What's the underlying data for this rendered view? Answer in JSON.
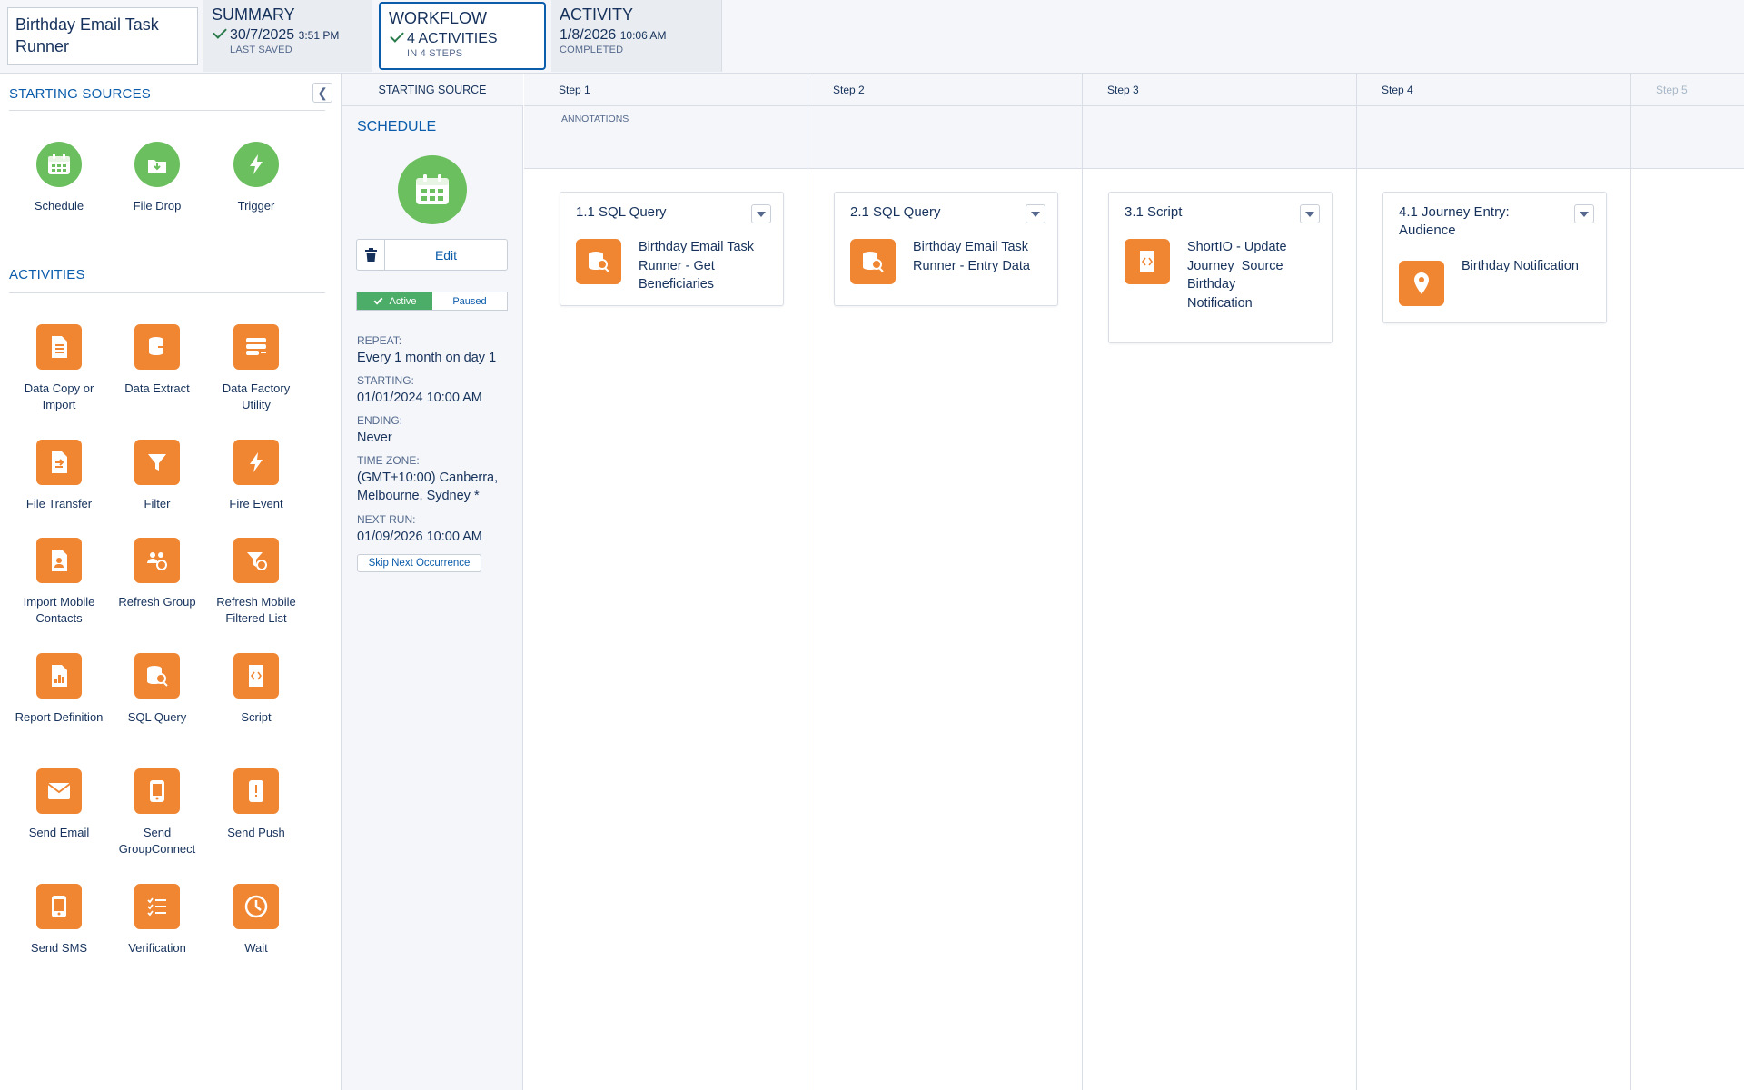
{
  "automation": {
    "name": "Birthday Email Task Runner"
  },
  "header_tabs": {
    "summary": {
      "title": "SUMMARY",
      "value": "30/7/2025",
      "time": "3:51 PM",
      "sub": "LAST SAVED"
    },
    "workflow": {
      "title": "WORKFLOW",
      "value": "4 ACTIVITIES",
      "sub": "IN 4 STEPS"
    },
    "activity": {
      "title": "ACTIVITY",
      "value": "1/8/2026",
      "time": "10:06 AM",
      "sub": "COMPLETED"
    }
  },
  "left_panel": {
    "starting_sources_title": "STARTING SOURCES",
    "starting_sources": [
      {
        "label": "Schedule",
        "icon": "calendar-icon"
      },
      {
        "label": "File Drop",
        "icon": "file-drop-icon"
      },
      {
        "label": "Trigger",
        "icon": "lightning-icon"
      }
    ],
    "activities_title": "ACTIVITIES",
    "activities": [
      {
        "label": "Data Copy or Import",
        "icon": "data-copy-icon"
      },
      {
        "label": "Data Extract",
        "icon": "data-extract-icon"
      },
      {
        "label": "Data Factory Utility",
        "icon": "data-factory-icon"
      },
      {
        "label": "File Transfer",
        "icon": "file-transfer-icon"
      },
      {
        "label": "Filter",
        "icon": "filter-icon"
      },
      {
        "label": "Fire Event",
        "icon": "fire-event-icon"
      },
      {
        "label": "Import Mobile Contacts",
        "icon": "import-contacts-icon"
      },
      {
        "label": "Refresh Group",
        "icon": "refresh-group-icon"
      },
      {
        "label": "Refresh Mobile Filtered List",
        "icon": "refresh-list-icon"
      },
      {
        "label": "Report Definition",
        "icon": "report-icon"
      },
      {
        "label": "SQL Query",
        "icon": "sql-query-icon"
      },
      {
        "label": "Script",
        "icon": "script-icon"
      },
      {
        "label": "Send Email",
        "icon": "envelope-icon"
      },
      {
        "label": "Send GroupConnect",
        "icon": "groupconnect-icon"
      },
      {
        "label": "Send Push",
        "icon": "push-icon"
      },
      {
        "label": "Send SMS",
        "icon": "sms-icon"
      },
      {
        "label": "Verification",
        "icon": "verification-icon"
      },
      {
        "label": "Wait",
        "icon": "clock-icon"
      }
    ]
  },
  "schedule": {
    "column_header": "STARTING SOURCE",
    "title": "SCHEDULE",
    "edit_label": "Edit",
    "active_label": "Active",
    "paused_label": "Paused",
    "repeat_label": "REPEAT:",
    "repeat_value": "Every 1 month on day 1",
    "starting_label": "STARTING:",
    "starting_value": "01/01/2024 10:00 AM",
    "ending_label": "ENDING:",
    "ending_value": "Never",
    "timezone_label": "TIME ZONE:",
    "timezone_value": "(GMT+10:00) Canberra, Melbourne, Sydney *",
    "next_run_label": "NEXT RUN:",
    "next_run_value": "01/09/2026 10:00 AM",
    "skip_label": "Skip Next Occurrence"
  },
  "canvas": {
    "steps": [
      "Step 1",
      "Step 2",
      "Step 3",
      "Step 4",
      "Step 5"
    ],
    "annotations_label": "ANNOTATIONS",
    "cards": [
      {
        "title": "1.1 SQL Query",
        "desc": "Birthday Email Task Runner - Get Beneficiaries",
        "icon": "sql-query-icon"
      },
      {
        "title": "2.1 SQL Query",
        "desc": "Birthday Email Task Runner - Entry Data",
        "icon": "sql-query-icon"
      },
      {
        "title": "3.1 Script",
        "desc": "ShortIO - Update Journey_Source Birthday Notification",
        "icon": "script-icon"
      },
      {
        "title": "4.1 Journey Entry: Audience",
        "desc": "Birthday Notification",
        "icon": "location-pin-icon"
      }
    ]
  },
  "colors": {
    "accent": "#0b5cab",
    "source_green": "#6bbf5e",
    "activity_orange": "#f08632",
    "active_green": "#4bad67"
  }
}
